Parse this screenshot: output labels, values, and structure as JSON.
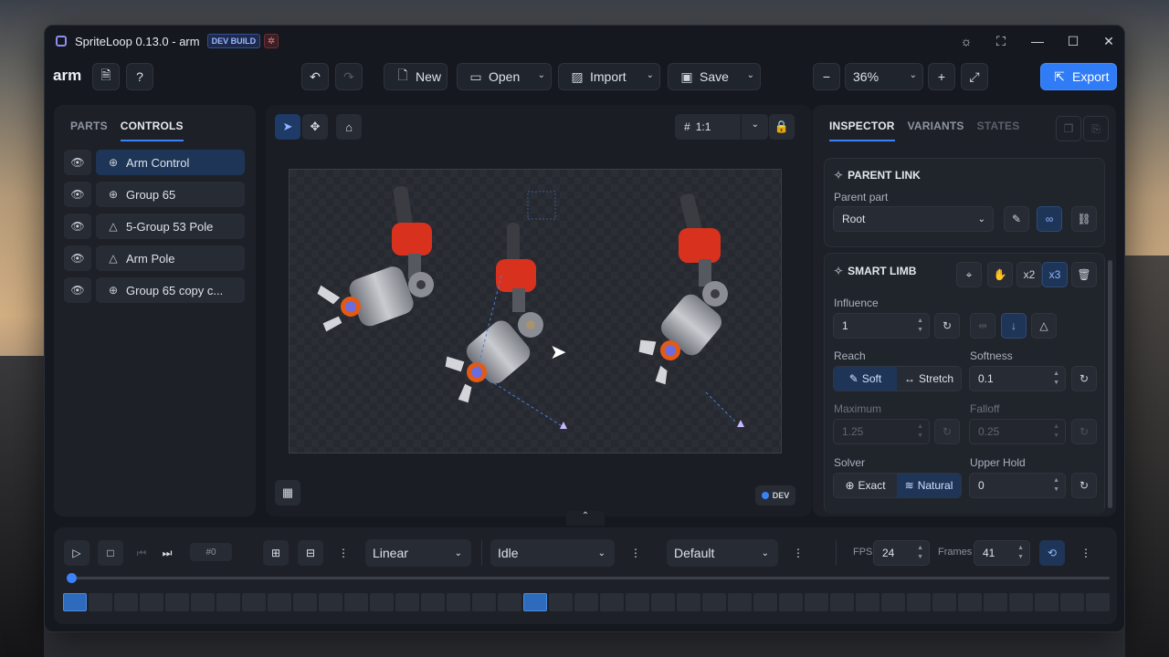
{
  "window": {
    "title": "SpriteLoop 0.13.0 - arm",
    "badge": "DEV BUILD"
  },
  "toolbar": {
    "project_name": "arm",
    "new_label": "New",
    "open_label": "Open",
    "import_label": "Import",
    "save_label": "Save",
    "zoom_value": "36%",
    "export_label": "Export"
  },
  "left_panel": {
    "tabs": [
      "PARTS",
      "CONTROLS"
    ],
    "active_tab": "CONTROLS",
    "items": [
      {
        "label": "Arm Control",
        "icon": "crosshair-icon",
        "selected": true
      },
      {
        "label": "Group 65",
        "icon": "crosshair-icon",
        "selected": false
      },
      {
        "label": "5-Group 53 Pole",
        "icon": "triangle-icon",
        "selected": false
      },
      {
        "label": "Arm Pole",
        "icon": "triangle-icon",
        "selected": false
      },
      {
        "label": "Group 65 copy c...",
        "icon": "crosshair-icon",
        "selected": false
      }
    ]
  },
  "canvas": {
    "grid_ratio": "1:1",
    "dev_badge": "DEV"
  },
  "inspector": {
    "tabs": [
      "INSPECTOR",
      "VARIANTS",
      "STATES"
    ],
    "active_tab": "INSPECTOR",
    "parent_link": {
      "title": "PARENT LINK",
      "parent_part_label": "Parent part",
      "parent_part_value": "Root"
    },
    "smart_limb": {
      "title": "SMART LIMB",
      "x2_label": "x2",
      "x3_label": "x3",
      "influence_label": "Influence",
      "influence_value": "1",
      "reach_label": "Reach",
      "reach_soft": "Soft",
      "reach_stretch": "Stretch",
      "softness_label": "Softness",
      "softness_value": "0.1",
      "maximum_label": "Maximum",
      "maximum_value": "1.25",
      "falloff_label": "Falloff",
      "falloff_value": "0.25",
      "solver_label": "Solver",
      "solver_exact": "Exact",
      "solver_natural": "Natural",
      "upper_hold_label": "Upper Hold",
      "upper_hold_value": "0"
    }
  },
  "timeline": {
    "frame_label": "#0",
    "interpolation": "Linear",
    "animation": "Idle",
    "variant": "Default",
    "fps_label": "FPS",
    "fps_value": "24",
    "frames_label": "Frames",
    "frames_value": "41"
  },
  "colors": {
    "accent": "#3b82f6",
    "limb_red": "#d8321e"
  }
}
